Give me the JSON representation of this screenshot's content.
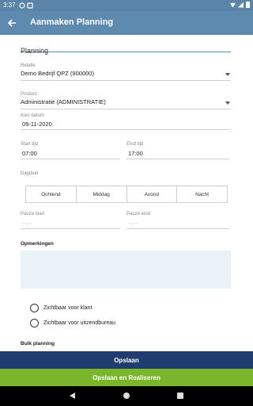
{
  "statusbar": {
    "time": "3:37"
  },
  "appbar": {
    "title": "Aanmaken Planning"
  },
  "form": {
    "planning_value": "Planning",
    "relatie": {
      "label": "Relatie",
      "value": "Demo Bedrijf QPZ (900000)"
    },
    "product": {
      "label": "Product",
      "value": "Administratie (ADMINISTRATIE)"
    },
    "datum": {
      "label": "Kies datum",
      "value": "09-11-2020"
    },
    "start": {
      "label": "Start tijd",
      "value": "07:00"
    },
    "eind": {
      "label": "Eind tijd",
      "value": "17:00"
    },
    "dagdeel": {
      "label": "Dagdeel",
      "options": [
        "Ochtend",
        "Middag",
        "Avond",
        "Nacht"
      ]
    },
    "pauze_start": {
      "label": "Pauze start",
      "placeholder": "--:--"
    },
    "pauze_eind": {
      "label": "Pauze eind",
      "placeholder": "--:--"
    },
    "opmerkingen_title": "Opmerkingen",
    "radio_klant": "Zichtbaar voor klant",
    "radio_uitzend": "Zichtbaar voor uitzendbureau",
    "bulk_title": "Bulk planning"
  },
  "buttons": {
    "save": "Opslaan",
    "save_realize": "Opslaan en Realiseren"
  }
}
